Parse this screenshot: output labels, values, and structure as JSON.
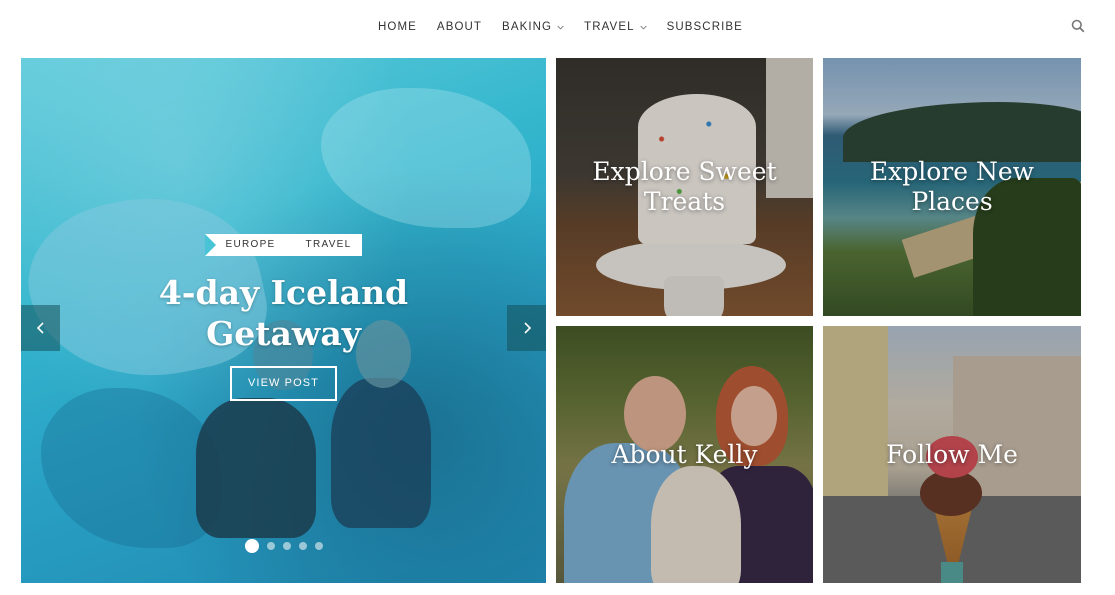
{
  "nav": {
    "items": [
      {
        "label": "HOME",
        "dropdown": false
      },
      {
        "label": "ABOUT",
        "dropdown": false
      },
      {
        "label": "BAKING",
        "dropdown": true
      },
      {
        "label": "TRAVEL",
        "dropdown": true
      },
      {
        "label": "SUBSCRIBE",
        "dropdown": false
      }
    ],
    "search_icon": "search-icon"
  },
  "slider": {
    "categories": [
      "EUROPE",
      "TRAVEL"
    ],
    "title": "4-day Iceland Getaway",
    "button_label": "VIEW POST",
    "prev_icon": "chevron-left-icon",
    "next_icon": "chevron-right-icon",
    "dots_total": 5,
    "active_dot": 1
  },
  "tiles": {
    "treats": "Explore Sweet Treats",
    "places": "Explore New Places",
    "about": "About Kelly",
    "follow": "Follow Me"
  },
  "colors": {
    "text": "#333333",
    "overlay_teal": "#37b9cf",
    "white": "#ffffff"
  }
}
